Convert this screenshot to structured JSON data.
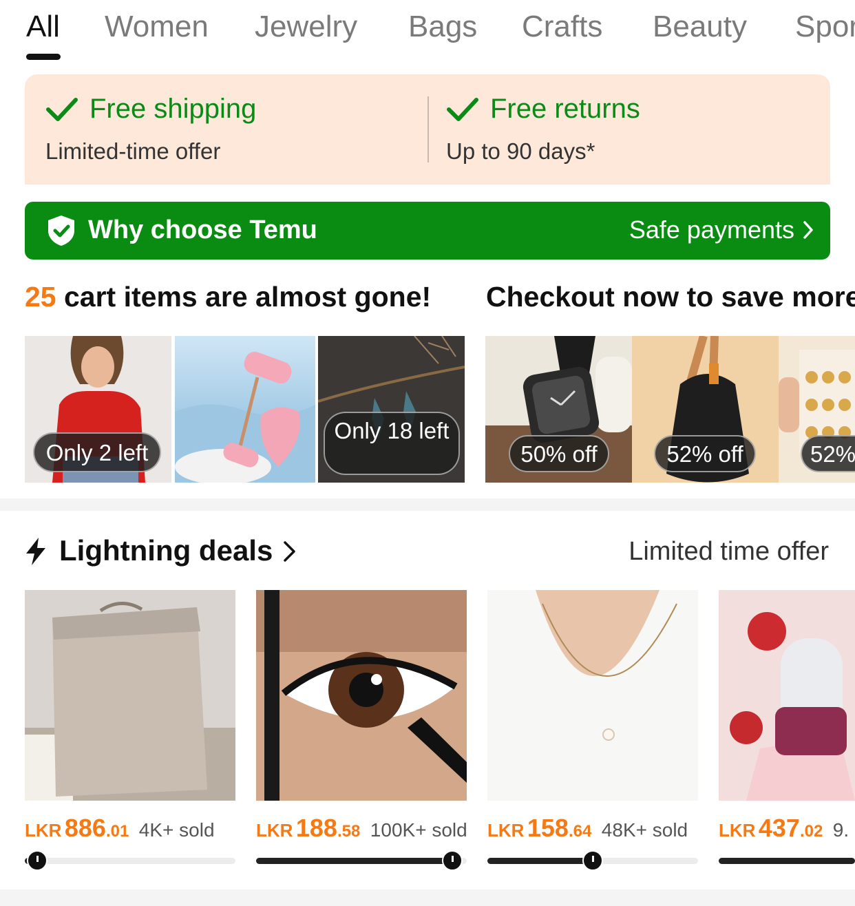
{
  "tabs": [
    {
      "label": "All",
      "active": true
    },
    {
      "label": "Women"
    },
    {
      "label": "Jewelry"
    },
    {
      "label": "Bags"
    },
    {
      "label": "Crafts"
    },
    {
      "label": "Beauty"
    },
    {
      "label": "Spor"
    }
  ],
  "promo": {
    "left": {
      "title": "Free shipping",
      "subtitle": "Limited-time offer"
    },
    "right": {
      "title": "Free returns",
      "subtitle": "Up to 90 days*"
    }
  },
  "why_bar": {
    "title": "Why choose Temu",
    "link": "Safe payments"
  },
  "cart": {
    "count": "25",
    "heading_rest": " cart items are almost gone!",
    "heading2": "Checkout now to save more",
    "items": [
      {
        "name": "red top",
        "badge": "Only 2 left"
      },
      {
        "name": "jade roller",
        "badge": ""
      },
      {
        "name": "earrings",
        "badge": "Only 18 left"
      },
      {
        "name": "watch",
        "badge": "50% off"
      },
      {
        "name": "sling bag",
        "badge": "52% off"
      },
      {
        "name": "earring set",
        "badge": "52%"
      }
    ]
  },
  "lightning": {
    "title": "Lightning deals",
    "right_text": "Limited time offer",
    "products": [
      {
        "name": "storage box",
        "currency": "LKR",
        "price_int": "886",
        "price_dec": ".01",
        "sold": "4K+ sold",
        "progress": 0.06
      },
      {
        "name": "eyeliner",
        "currency": "LKR",
        "price_int": "188",
        "price_dec": ".58",
        "sold": "100K+ sold",
        "progress": 0.93
      },
      {
        "name": "pearl necklace",
        "currency": "LKR",
        "price_int": "158",
        "price_dec": ".64",
        "sold": "48K+ sold",
        "progress": 0.5
      },
      {
        "name": "face roller",
        "currency": "LKR",
        "price_int": "437",
        "price_dec": ".02",
        "sold": "9.",
        "progress": 1.0
      }
    ]
  },
  "colors": {
    "accent_orange": "#f57a14",
    "green": "#0a8b12",
    "promo_bg": "#fde8da"
  }
}
